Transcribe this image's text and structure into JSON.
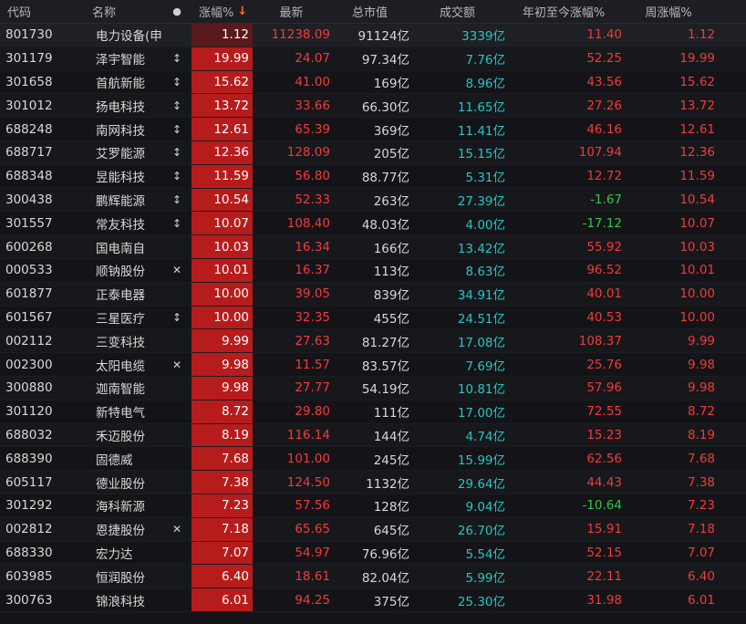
{
  "header": {
    "code": "代码",
    "name": "名称",
    "flag": "●",
    "pct": "涨幅%",
    "sort_arrow": "↓",
    "last": "最新",
    "mcap": "总市值",
    "volume": "成交额",
    "ytd": "年初至今涨幅%",
    "week": "周涨幅%"
  },
  "rows": [
    {
      "code": "801730",
      "name": "电力设备(申万",
      "flag": "",
      "pct": "1.12",
      "last": "11238.09",
      "mcap": "91124亿",
      "volume": "3339亿",
      "ytd": "11.40",
      "week": "1.12"
    },
    {
      "code": "301179",
      "name": "泽宇智能",
      "flag": "↕",
      "pct": "19.99",
      "last": "24.07",
      "mcap": "97.34亿",
      "volume": "7.76亿",
      "ytd": "52.25",
      "week": "19.99"
    },
    {
      "code": "301658",
      "name": "首航新能",
      "flag": "↕",
      "pct": "15.62",
      "last": "41.00",
      "mcap": "169亿",
      "volume": "8.96亿",
      "ytd": "43.56",
      "week": "15.62"
    },
    {
      "code": "301012",
      "name": "扬电科技",
      "flag": "↕",
      "pct": "13.72",
      "last": "33.66",
      "mcap": "66.30亿",
      "volume": "11.65亿",
      "ytd": "27.26",
      "week": "13.72"
    },
    {
      "code": "688248",
      "name": "南网科技",
      "flag": "↕",
      "pct": "12.61",
      "last": "65.39",
      "mcap": "369亿",
      "volume": "11.41亿",
      "ytd": "46.16",
      "week": "12.61"
    },
    {
      "code": "688717",
      "name": "艾罗能源",
      "flag": "↕",
      "pct": "12.36",
      "last": "128.09",
      "mcap": "205亿",
      "volume": "15.15亿",
      "ytd": "107.94",
      "week": "12.36"
    },
    {
      "code": "688348",
      "name": "昱能科技",
      "flag": "↕",
      "pct": "11.59",
      "last": "56.80",
      "mcap": "88.77亿",
      "volume": "5.31亿",
      "ytd": "12.72",
      "week": "11.59"
    },
    {
      "code": "300438",
      "name": "鹏辉能源",
      "flag": "↕",
      "pct": "10.54",
      "last": "52.33",
      "mcap": "263亿",
      "volume": "27.39亿",
      "ytd": "-1.67",
      "week": "10.54"
    },
    {
      "code": "301557",
      "name": "常友科技",
      "flag": "↕",
      "pct": "10.07",
      "last": "108.40",
      "mcap": "48.03亿",
      "volume": "4.00亿",
      "ytd": "-17.12",
      "week": "10.07"
    },
    {
      "code": "600268",
      "name": "国电南自",
      "flag": "",
      "pct": "10.03",
      "last": "16.34",
      "mcap": "166亿",
      "volume": "13.42亿",
      "ytd": "55.92",
      "week": "10.03"
    },
    {
      "code": "000533",
      "name": "顺钠股份",
      "flag": "✕",
      "pct": "10.01",
      "last": "16.37",
      "mcap": "113亿",
      "volume": "8.63亿",
      "ytd": "96.52",
      "week": "10.01"
    },
    {
      "code": "601877",
      "name": "正泰电器",
      "flag": "",
      "pct": "10.00",
      "last": "39.05",
      "mcap": "839亿",
      "volume": "34.91亿",
      "ytd": "40.01",
      "week": "10.00"
    },
    {
      "code": "601567",
      "name": "三星医疗",
      "flag": "↕",
      "pct": "10.00",
      "last": "32.35",
      "mcap": "455亿",
      "volume": "24.51亿",
      "ytd": "40.53",
      "week": "10.00"
    },
    {
      "code": "002112",
      "name": "三变科技",
      "flag": "",
      "pct": "9.99",
      "last": "27.63",
      "mcap": "81.27亿",
      "volume": "17.08亿",
      "ytd": "108.37",
      "week": "9.99"
    },
    {
      "code": "002300",
      "name": "太阳电缆",
      "flag": "✕",
      "pct": "9.98",
      "last": "11.57",
      "mcap": "83.57亿",
      "volume": "7.69亿",
      "ytd": "25.76",
      "week": "9.98"
    },
    {
      "code": "300880",
      "name": "迦南智能",
      "flag": "",
      "pct": "9.98",
      "last": "27.77",
      "mcap": "54.19亿",
      "volume": "10.81亿",
      "ytd": "57.96",
      "week": "9.98"
    },
    {
      "code": "301120",
      "name": "新特电气",
      "flag": "",
      "pct": "8.72",
      "last": "29.80",
      "mcap": "111亿",
      "volume": "17.00亿",
      "ytd": "72.55",
      "week": "8.72"
    },
    {
      "code": "688032",
      "name": "禾迈股份",
      "flag": "",
      "pct": "8.19",
      "last": "116.14",
      "mcap": "144亿",
      "volume": "4.74亿",
      "ytd": "15.23",
      "week": "8.19"
    },
    {
      "code": "688390",
      "name": "固德威",
      "flag": "",
      "pct": "7.68",
      "last": "101.00",
      "mcap": "245亿",
      "volume": "15.99亿",
      "ytd": "62.56",
      "week": "7.68"
    },
    {
      "code": "605117",
      "name": "德业股份",
      "flag": "",
      "pct": "7.38",
      "last": "124.50",
      "mcap": "1132亿",
      "volume": "29.64亿",
      "ytd": "44.43",
      "week": "7.38"
    },
    {
      "code": "301292",
      "name": "海科新源",
      "flag": "",
      "pct": "7.23",
      "last": "57.56",
      "mcap": "128亿",
      "volume": "9.04亿",
      "ytd": "-10.64",
      "week": "7.23"
    },
    {
      "code": "002812",
      "name": "恩捷股份",
      "flag": "✕",
      "pct": "7.18",
      "last": "65.65",
      "mcap": "645亿",
      "volume": "26.70亿",
      "ytd": "15.91",
      "week": "7.18"
    },
    {
      "code": "688330",
      "name": "宏力达",
      "flag": "",
      "pct": "7.07",
      "last": "54.97",
      "mcap": "76.96亿",
      "volume": "5.54亿",
      "ytd": "52.15",
      "week": "7.07"
    },
    {
      "code": "603985",
      "name": "恒润股份",
      "flag": "",
      "pct": "6.40",
      "last": "18.61",
      "mcap": "82.04亿",
      "volume": "5.99亿",
      "ytd": "22.11",
      "week": "6.40"
    },
    {
      "code": "300763",
      "name": "锦浪科技",
      "flag": "",
      "pct": "6.01",
      "last": "94.25",
      "mcap": "375亿",
      "volume": "25.30亿",
      "ytd": "31.98",
      "week": "6.01"
    }
  ],
  "colors": {
    "up": "#f23a3a",
    "down": "#31c447",
    "volume": "#29c4c4",
    "pct_bg": "#b71c1c",
    "sort_arrow": "#ff6a2a"
  }
}
